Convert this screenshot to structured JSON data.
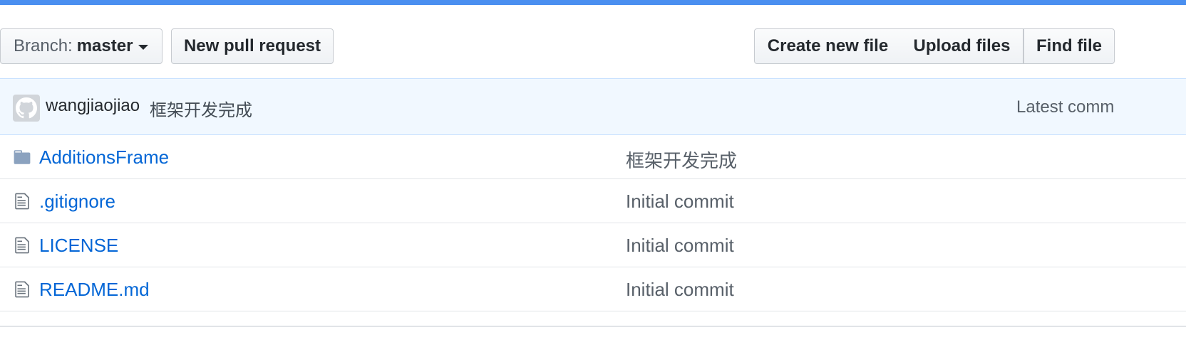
{
  "toolbar": {
    "branch_prefix": "Branch:",
    "branch_name": "master",
    "new_pull_request": "New pull request",
    "create_new_file": "Create new file",
    "upload_files": "Upload files",
    "find_file": "Find file"
  },
  "commit": {
    "author": "wangjiaojiao",
    "message": "框架开发完成",
    "latest_label": "Latest comm"
  },
  "files": [
    {
      "icon": "folder-icon",
      "name": "AdditionsFrame",
      "message": "框架开发完成"
    },
    {
      "icon": "file-text-icon",
      "name": ".gitignore",
      "message": "Initial commit"
    },
    {
      "icon": "file-text-icon",
      "name": "LICENSE",
      "message": "Initial commit"
    },
    {
      "icon": "file-text-icon",
      "name": "README.md",
      "message": "Initial commit"
    }
  ],
  "colors": {
    "top_bar": "#4a8ff0",
    "link": "#0366d6",
    "commit_bar_bg": "#f1f8ff"
  }
}
